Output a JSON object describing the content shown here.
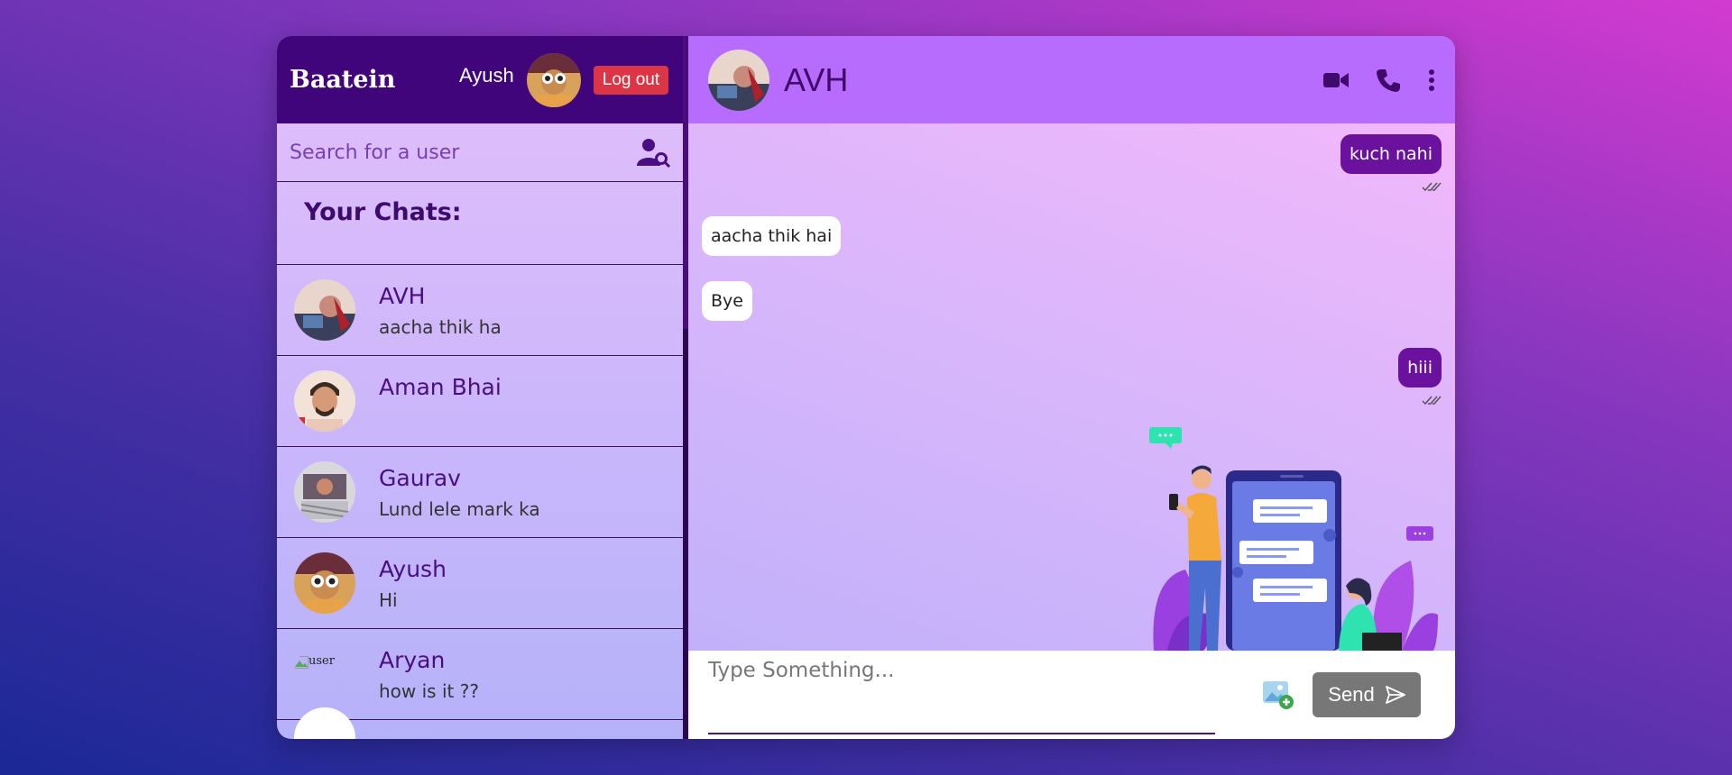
{
  "app": {
    "brand": "Baatein"
  },
  "user": {
    "name": "Ayush",
    "logout_label": "Log out"
  },
  "search": {
    "placeholder": "Search for a user"
  },
  "chats_heading": "Your Chats:",
  "chats": [
    {
      "name": "AVH",
      "last_message": "aacha thik ha",
      "avatar": "photo"
    },
    {
      "name": "Aman Bhai",
      "last_message": "",
      "avatar": "photo"
    },
    {
      "name": "Gaurav",
      "last_message": "Lund lele mark ka",
      "avatar": "photo"
    },
    {
      "name": "Ayush",
      "last_message": "Hi",
      "avatar": "photo"
    },
    {
      "name": "Aryan",
      "last_message": "how is it ??",
      "avatar": "broken",
      "avatar_alt": "user"
    }
  ],
  "conversation": {
    "contact_name": "AVH",
    "messages": [
      {
        "text": "kuch nahi",
        "direction": "sent",
        "status": "read"
      },
      {
        "text": "aacha thik hai",
        "direction": "recv"
      },
      {
        "text": "Bye",
        "direction": "recv"
      },
      {
        "text": "hiii",
        "direction": "sent",
        "status": "read"
      }
    ]
  },
  "compose": {
    "placeholder": "Type Something...",
    "send_label": "Send"
  },
  "icons": {
    "search_user": "user-search-icon",
    "video": "video-camera-icon",
    "call": "phone-icon",
    "menu": "more-vertical-icon",
    "attach": "add-image-icon",
    "send": "send-arrow-icon",
    "read": "double-check-icon"
  },
  "colors": {
    "header_dark": "#40057a",
    "header_light": "#b76cfd",
    "sent_bubble": "#6a119e",
    "logout": "#dc3545",
    "send_button": "#777777"
  }
}
